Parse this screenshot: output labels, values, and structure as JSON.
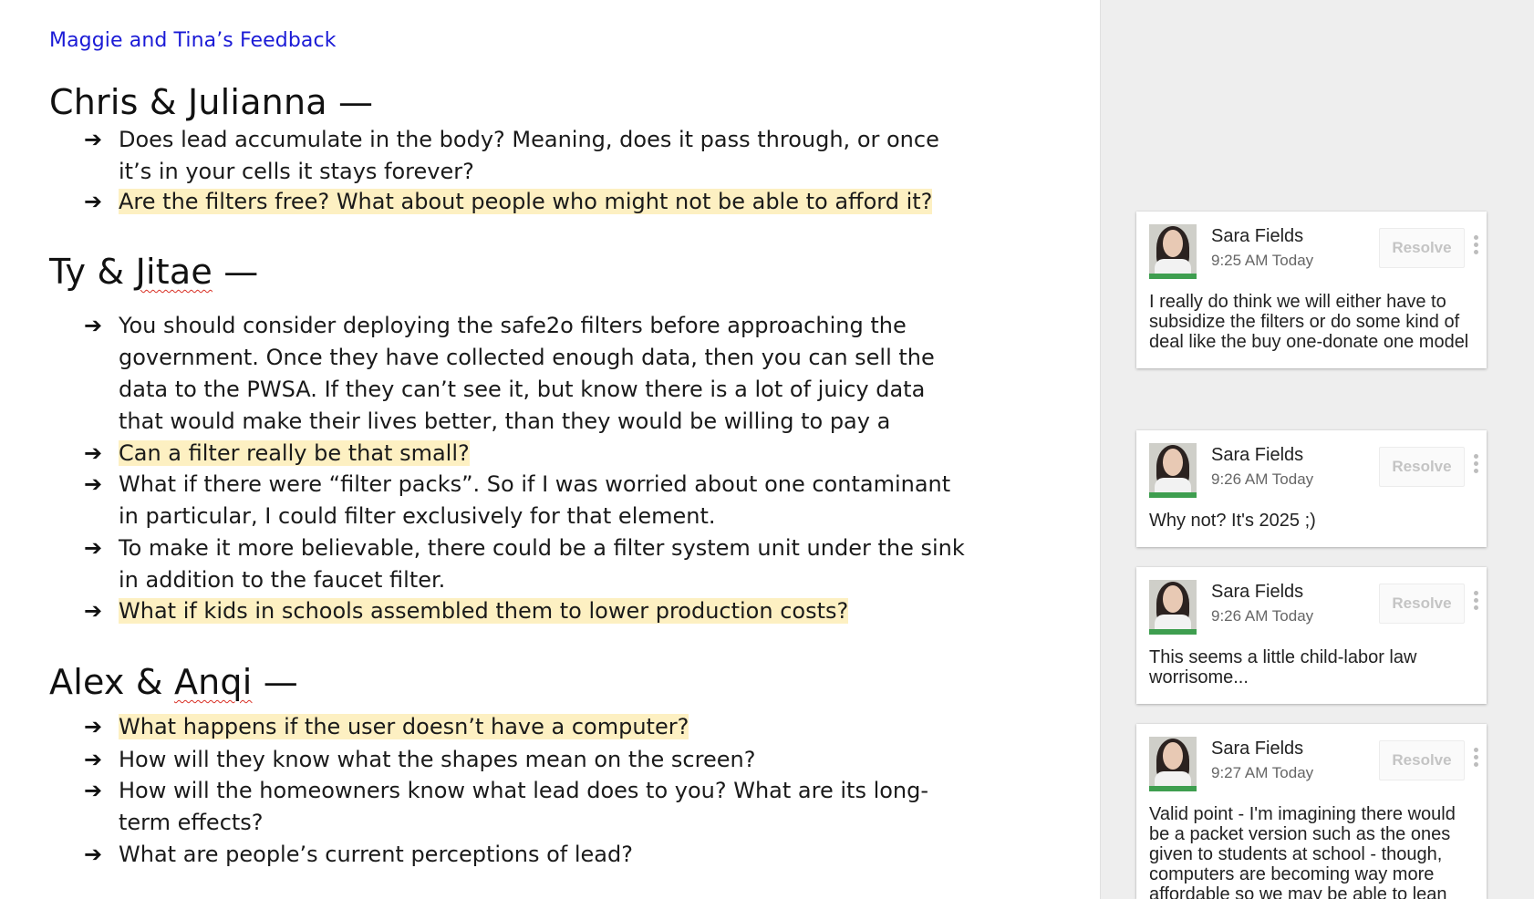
{
  "doc": {
    "link": "Maggie and Tina’s Feedback",
    "sections": [
      {
        "title": "Chris & Julianna —",
        "bullets": [
          {
            "text": "Does lead accumulate in the body? Meaning, does it pass through, or once it’s in your cells it stays forever?",
            "highlighted": false
          },
          {
            "text": "Are the filters free? What about people who might not be able to afford it?",
            "highlighted": true
          }
        ]
      },
      {
        "title_pre": "Ty & ",
        "title_misspelled": "Jitae",
        "title_post": " —",
        "bullets": [
          {
            "text": "You should consider deploying the safe2o filters before approaching the government. Once they have collected enough data, then you can sell the data to the PWSA. If they can’t see it, but know there is a lot of juicy data that would make their lives better, than they would be willing to pay a premium.",
            "highlighted": false
          },
          {
            "text": "Can a filter really be that small?",
            "highlighted": true
          },
          {
            "text": "What if there were “filter packs”. So if I was worried about one contaminant in particular, I could filter exclusively for that element.",
            "highlighted": false
          },
          {
            "text": "To make it more believable, there could be a filter system unit under the sink in addition to the faucet filter.",
            "highlighted": false
          },
          {
            "text": "What if kids in schools assembled them to lower production costs?",
            "highlighted": true
          }
        ]
      },
      {
        "title_pre": "Alex & ",
        "title_misspelled": "Anqi",
        "title_post": " —",
        "bullets": [
          {
            "text": "What happens if the user doesn’t have a computer?",
            "highlighted": true
          },
          {
            "text": "How will they know what the shapes mean on the screen?",
            "highlighted": false
          },
          {
            "text": "How will the homeowners know what lead does to you? What are its long-term effects?",
            "highlighted": false
          },
          {
            "text": "What are people’s current perceptions of lead?",
            "highlighted": false
          }
        ]
      }
    ],
    "arrow": "➔"
  },
  "comments": [
    {
      "author": "Sara Fields",
      "time": "9:25 AM Today",
      "resolve": "Resolve",
      "text": "I really do think we will either have to subsidize the filters or do some kind of deal like the buy one-donate one model"
    },
    {
      "author": "Sara Fields",
      "time": "9:26 AM Today",
      "resolve": "Resolve",
      "text": "Why not? It's 2025 ;)"
    },
    {
      "author": "Sara Fields",
      "time": "9:26 AM Today",
      "resolve": "Resolve",
      "text": "This seems a little child-labor law worrisome..."
    },
    {
      "author": "Sara Fields",
      "time": "9:27 AM Today",
      "resolve": "Resolve",
      "text": "Valid point - I'm imagining there would be a packet version such as the ones given to students at school - though, computers are becoming way more affordable so we may be able to lean"
    }
  ],
  "colors": {
    "link": "#1a1ad6",
    "highlight": "#fdf0c2",
    "avatar_bar": "#3e9e4f",
    "pane_bg": "#eeeeee"
  }
}
